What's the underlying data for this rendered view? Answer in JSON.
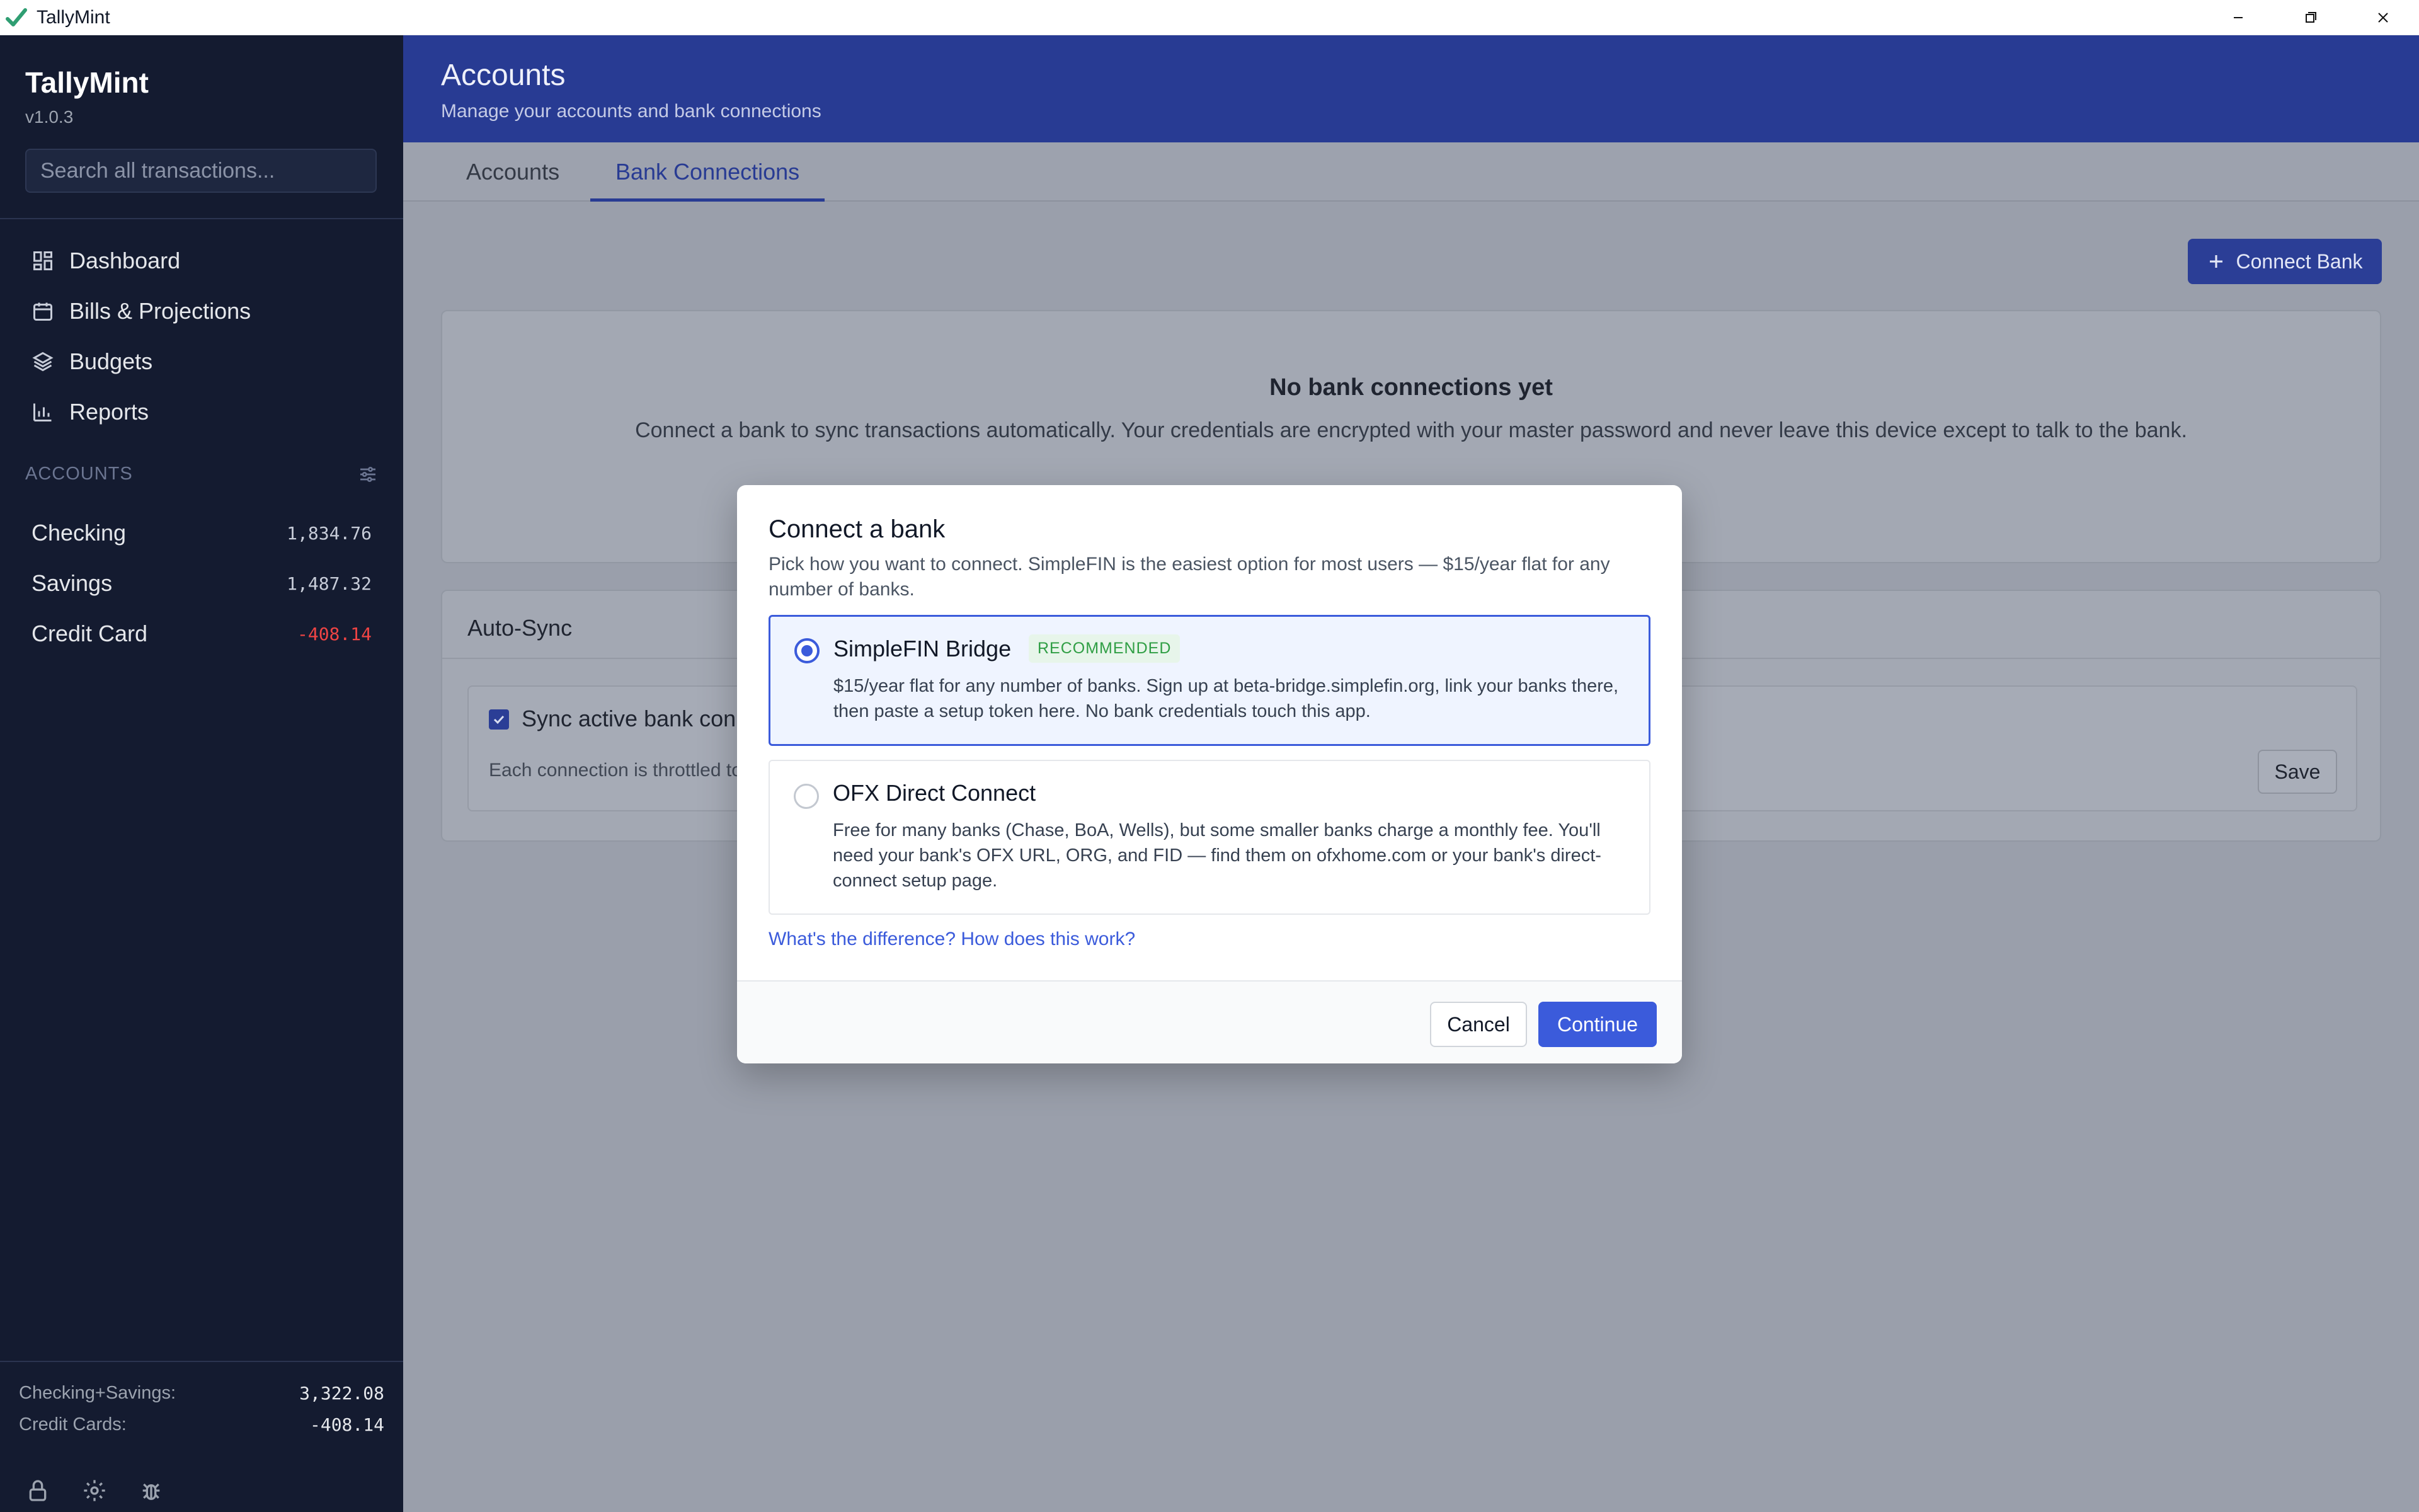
{
  "window": {
    "title": "TallyMint"
  },
  "sidebar": {
    "brand": "TallyMint",
    "version": "v1.0.3",
    "search_placeholder": "Search all transactions...",
    "nav": [
      {
        "label": "Dashboard",
        "icon": "grid-icon"
      },
      {
        "label": "Bills & Projections",
        "icon": "calendar-icon"
      },
      {
        "label": "Budgets",
        "icon": "layers-icon"
      },
      {
        "label": "Reports",
        "icon": "bar-chart-icon"
      }
    ],
    "accounts_label": "ACCOUNTS",
    "accounts": [
      {
        "name": "Checking",
        "balance": "1,834.76"
      },
      {
        "name": "Savings",
        "balance": "1,487.32"
      },
      {
        "name": "Credit Card",
        "balance": "-408.14"
      }
    ],
    "totals": [
      {
        "label": "Checking+Savings:",
        "value": "3,322.08"
      },
      {
        "label": "Credit Cards:",
        "value": "-408.14"
      }
    ]
  },
  "header": {
    "title": "Accounts",
    "subtitle": "Manage your accounts and bank connections"
  },
  "tabs": [
    {
      "label": "Accounts",
      "active": false
    },
    {
      "label": "Bank Connections",
      "active": true
    }
  ],
  "connect_bank_label": "Connect Bank",
  "empty_state": {
    "title": "No bank connections yet",
    "description": "Connect a bank to sync transactions automatically. Your credentials are encrypted with your master password and never leave this device except to talk to the bank."
  },
  "auto_sync": {
    "title": "Auto-Sync",
    "checkbox_label": "Sync active bank conn",
    "note": "Each connection is throttled to",
    "save_label": "Save"
  },
  "modal": {
    "title": "Connect a bank",
    "description": "Pick how you want to connect. SimpleFIN is the easiest option for most users — $15/year flat for any number of banks.",
    "options": [
      {
        "title": "SimpleFIN Bridge",
        "badge": "RECOMMENDED",
        "description": "$15/year flat for any number of banks. Sign up at beta-bridge.simplefin.org, link your banks there, then paste a setup token here. No bank credentials touch this app.",
        "selected": true
      },
      {
        "title": "OFX Direct Connect",
        "description": "Free for many banks (Chase, BoA, Wells), but some smaller banks charge a monthly fee. You'll need your bank's OFX URL, ORG, and FID — find them on ofxhome.com or your bank's direct-connect setup page.",
        "selected": false
      }
    ],
    "help_link": "What's the difference? How does this work?",
    "cancel_label": "Cancel",
    "continue_label": "Continue"
  },
  "colors": {
    "sidebar_bg": "#141b30",
    "header_bg": "#283b93",
    "accent": "#3b5bdb",
    "negative": "#ef4444",
    "badge_green": "#2f9e44"
  }
}
